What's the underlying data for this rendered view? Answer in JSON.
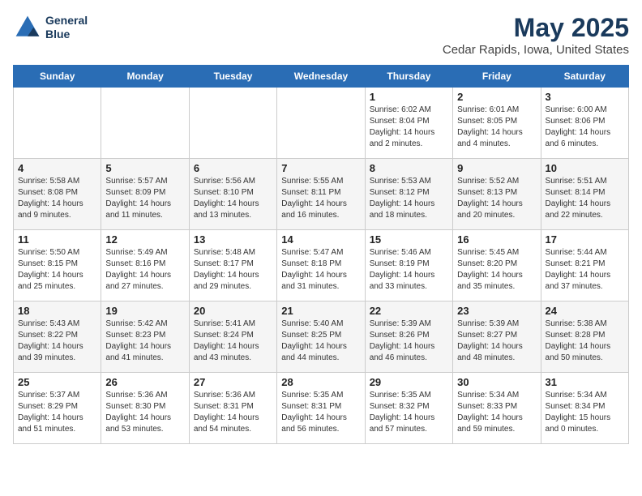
{
  "header": {
    "logo_line1": "General",
    "logo_line2": "Blue",
    "title": "May 2025",
    "subtitle": "Cedar Rapids, Iowa, United States"
  },
  "days_of_week": [
    "Sunday",
    "Monday",
    "Tuesday",
    "Wednesday",
    "Thursday",
    "Friday",
    "Saturday"
  ],
  "weeks": [
    [
      {
        "day": "",
        "info": ""
      },
      {
        "day": "",
        "info": ""
      },
      {
        "day": "",
        "info": ""
      },
      {
        "day": "",
        "info": ""
      },
      {
        "day": "1",
        "info": "Sunrise: 6:02 AM\nSunset: 8:04 PM\nDaylight: 14 hours\nand 2 minutes."
      },
      {
        "day": "2",
        "info": "Sunrise: 6:01 AM\nSunset: 8:05 PM\nDaylight: 14 hours\nand 4 minutes."
      },
      {
        "day": "3",
        "info": "Sunrise: 6:00 AM\nSunset: 8:06 PM\nDaylight: 14 hours\nand 6 minutes."
      }
    ],
    [
      {
        "day": "4",
        "info": "Sunrise: 5:58 AM\nSunset: 8:08 PM\nDaylight: 14 hours\nand 9 minutes."
      },
      {
        "day": "5",
        "info": "Sunrise: 5:57 AM\nSunset: 8:09 PM\nDaylight: 14 hours\nand 11 minutes."
      },
      {
        "day": "6",
        "info": "Sunrise: 5:56 AM\nSunset: 8:10 PM\nDaylight: 14 hours\nand 13 minutes."
      },
      {
        "day": "7",
        "info": "Sunrise: 5:55 AM\nSunset: 8:11 PM\nDaylight: 14 hours\nand 16 minutes."
      },
      {
        "day": "8",
        "info": "Sunrise: 5:53 AM\nSunset: 8:12 PM\nDaylight: 14 hours\nand 18 minutes."
      },
      {
        "day": "9",
        "info": "Sunrise: 5:52 AM\nSunset: 8:13 PM\nDaylight: 14 hours\nand 20 minutes."
      },
      {
        "day": "10",
        "info": "Sunrise: 5:51 AM\nSunset: 8:14 PM\nDaylight: 14 hours\nand 22 minutes."
      }
    ],
    [
      {
        "day": "11",
        "info": "Sunrise: 5:50 AM\nSunset: 8:15 PM\nDaylight: 14 hours\nand 25 minutes."
      },
      {
        "day": "12",
        "info": "Sunrise: 5:49 AM\nSunset: 8:16 PM\nDaylight: 14 hours\nand 27 minutes."
      },
      {
        "day": "13",
        "info": "Sunrise: 5:48 AM\nSunset: 8:17 PM\nDaylight: 14 hours\nand 29 minutes."
      },
      {
        "day": "14",
        "info": "Sunrise: 5:47 AM\nSunset: 8:18 PM\nDaylight: 14 hours\nand 31 minutes."
      },
      {
        "day": "15",
        "info": "Sunrise: 5:46 AM\nSunset: 8:19 PM\nDaylight: 14 hours\nand 33 minutes."
      },
      {
        "day": "16",
        "info": "Sunrise: 5:45 AM\nSunset: 8:20 PM\nDaylight: 14 hours\nand 35 minutes."
      },
      {
        "day": "17",
        "info": "Sunrise: 5:44 AM\nSunset: 8:21 PM\nDaylight: 14 hours\nand 37 minutes."
      }
    ],
    [
      {
        "day": "18",
        "info": "Sunrise: 5:43 AM\nSunset: 8:22 PM\nDaylight: 14 hours\nand 39 minutes."
      },
      {
        "day": "19",
        "info": "Sunrise: 5:42 AM\nSunset: 8:23 PM\nDaylight: 14 hours\nand 41 minutes."
      },
      {
        "day": "20",
        "info": "Sunrise: 5:41 AM\nSunset: 8:24 PM\nDaylight: 14 hours\nand 43 minutes."
      },
      {
        "day": "21",
        "info": "Sunrise: 5:40 AM\nSunset: 8:25 PM\nDaylight: 14 hours\nand 44 minutes."
      },
      {
        "day": "22",
        "info": "Sunrise: 5:39 AM\nSunset: 8:26 PM\nDaylight: 14 hours\nand 46 minutes."
      },
      {
        "day": "23",
        "info": "Sunrise: 5:39 AM\nSunset: 8:27 PM\nDaylight: 14 hours\nand 48 minutes."
      },
      {
        "day": "24",
        "info": "Sunrise: 5:38 AM\nSunset: 8:28 PM\nDaylight: 14 hours\nand 50 minutes."
      }
    ],
    [
      {
        "day": "25",
        "info": "Sunrise: 5:37 AM\nSunset: 8:29 PM\nDaylight: 14 hours\nand 51 minutes."
      },
      {
        "day": "26",
        "info": "Sunrise: 5:36 AM\nSunset: 8:30 PM\nDaylight: 14 hours\nand 53 minutes."
      },
      {
        "day": "27",
        "info": "Sunrise: 5:36 AM\nSunset: 8:31 PM\nDaylight: 14 hours\nand 54 minutes."
      },
      {
        "day": "28",
        "info": "Sunrise: 5:35 AM\nSunset: 8:31 PM\nDaylight: 14 hours\nand 56 minutes."
      },
      {
        "day": "29",
        "info": "Sunrise: 5:35 AM\nSunset: 8:32 PM\nDaylight: 14 hours\nand 57 minutes."
      },
      {
        "day": "30",
        "info": "Sunrise: 5:34 AM\nSunset: 8:33 PM\nDaylight: 14 hours\nand 59 minutes."
      },
      {
        "day": "31",
        "info": "Sunrise: 5:34 AM\nSunset: 8:34 PM\nDaylight: 15 hours\nand 0 minutes."
      }
    ]
  ]
}
